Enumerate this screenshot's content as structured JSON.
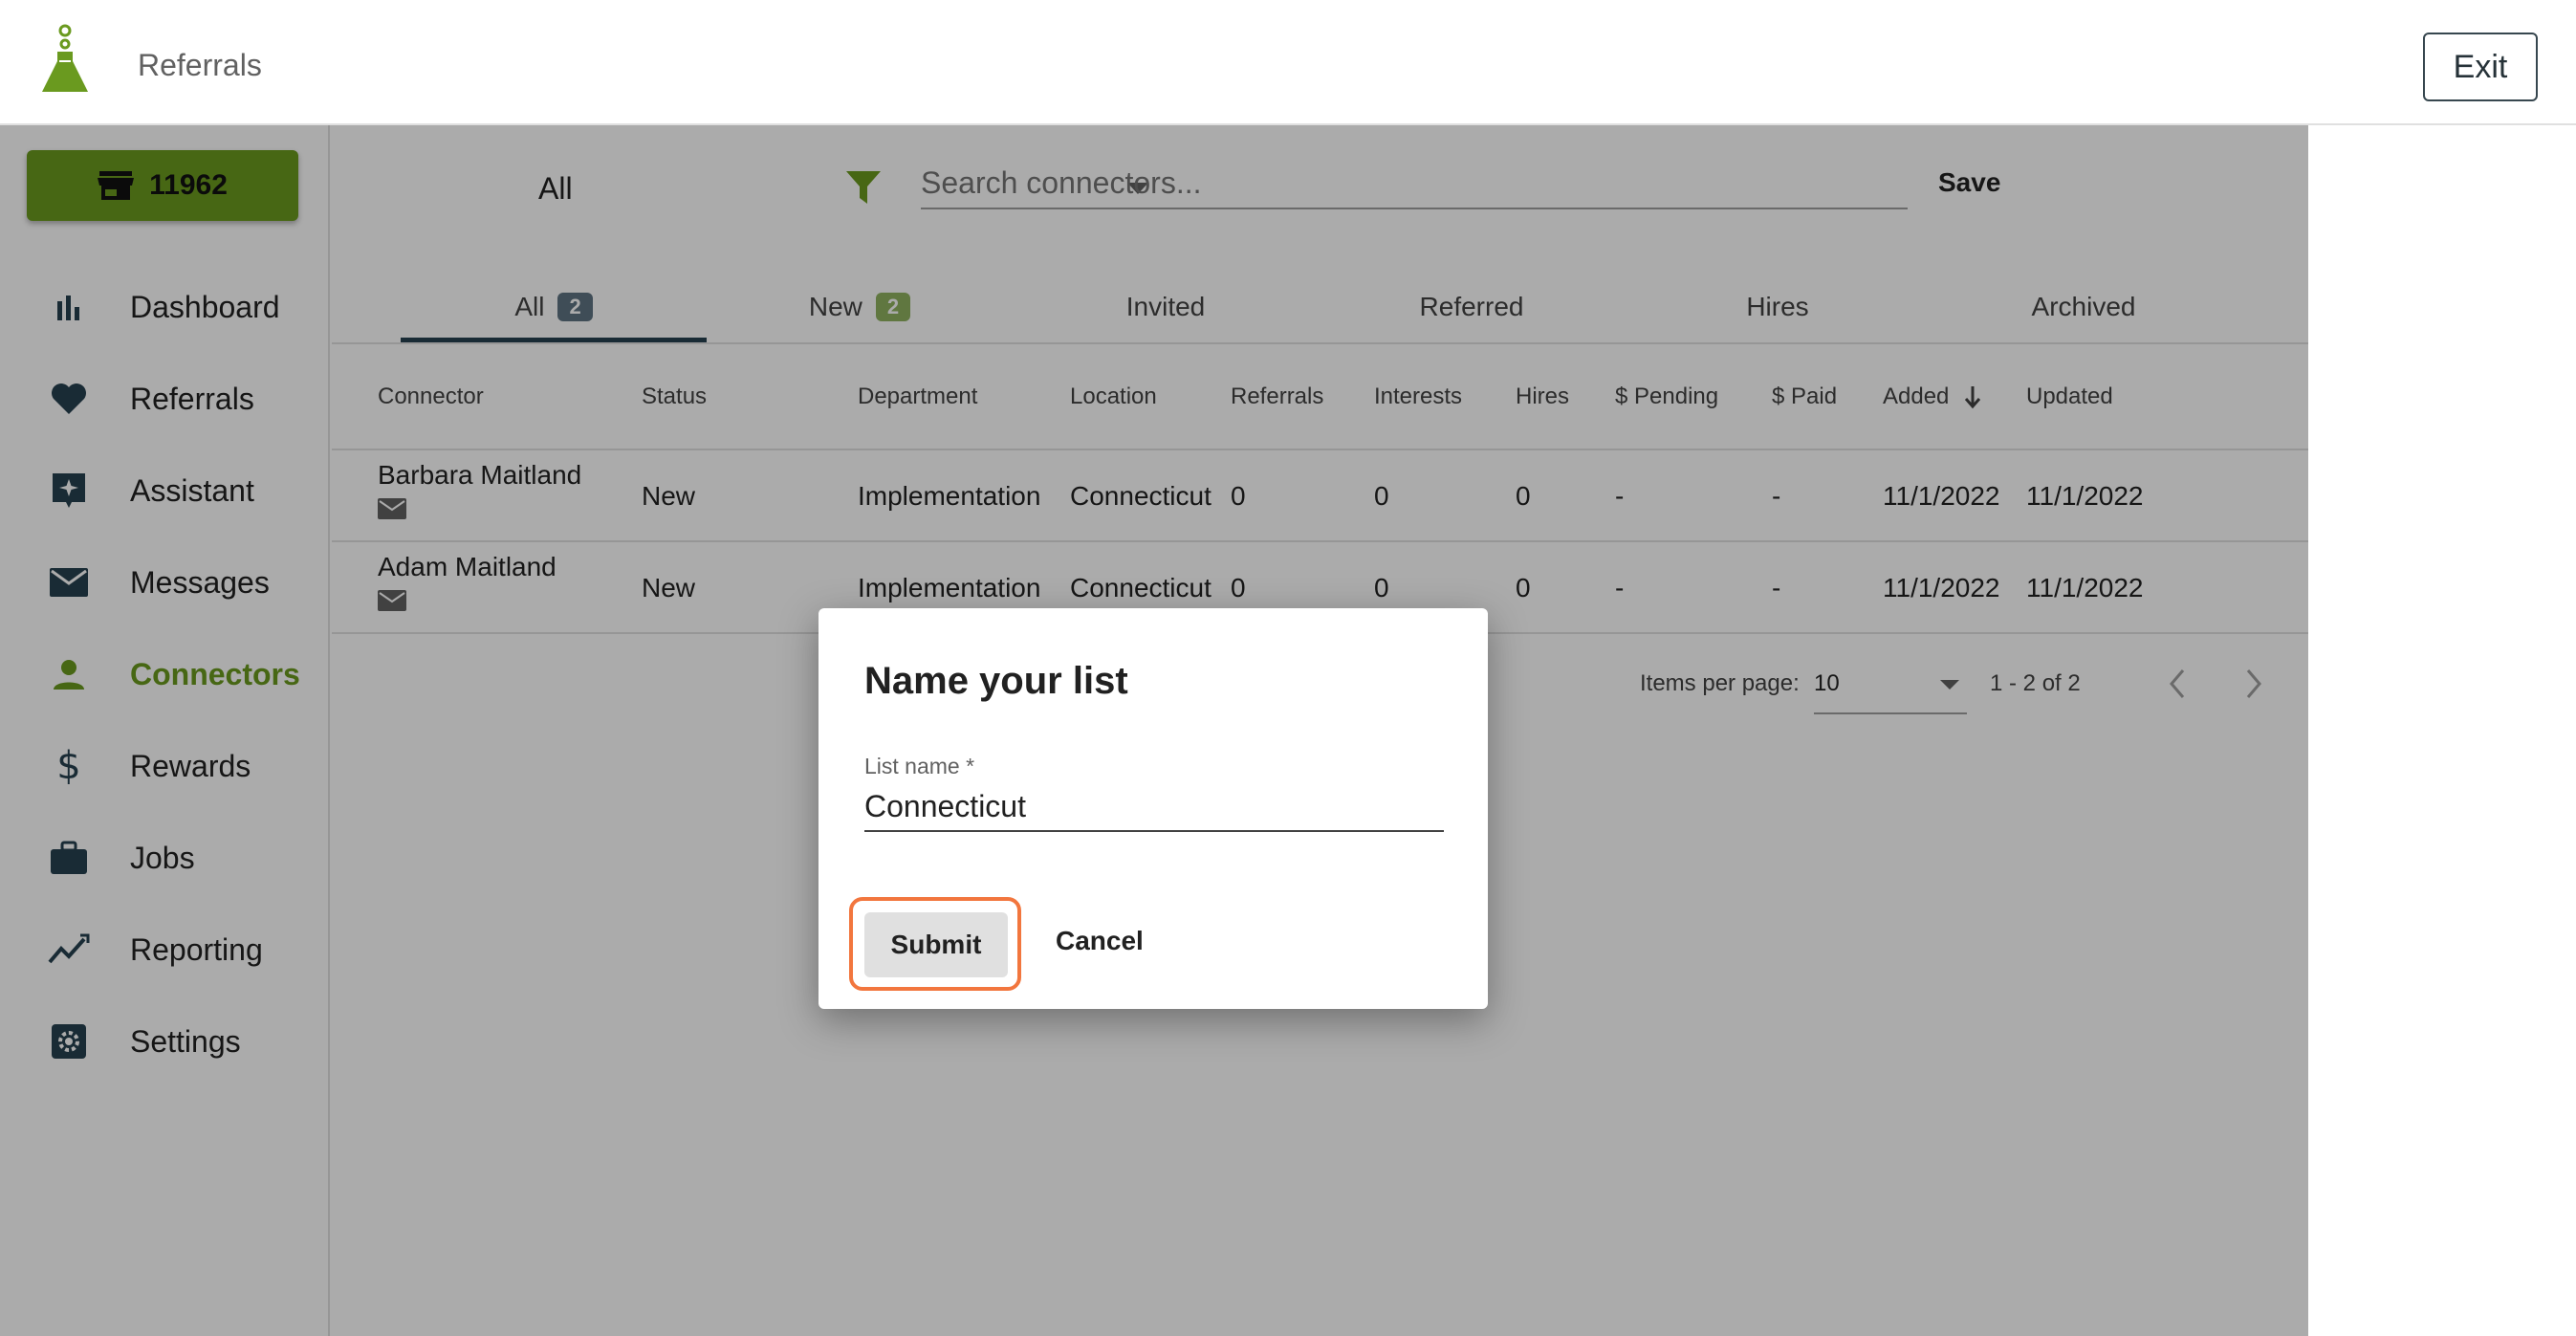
{
  "header": {
    "title": "Referrals",
    "exit_label": "Exit"
  },
  "sidebar": {
    "store_button": "11962",
    "items": [
      {
        "label": "Dashboard",
        "icon": "bar-chart-icon"
      },
      {
        "label": "Referrals",
        "icon": "heart-icon"
      },
      {
        "label": "Assistant",
        "icon": "sparkle-icon"
      },
      {
        "label": "Messages",
        "icon": "envelope-icon"
      },
      {
        "label": "Connectors",
        "icon": "person-icon",
        "active": true
      },
      {
        "label": "Rewards",
        "icon": "dollar-icon"
      },
      {
        "label": "Jobs",
        "icon": "briefcase-icon"
      },
      {
        "label": "Reporting",
        "icon": "trend-icon"
      },
      {
        "label": "Settings",
        "icon": "gear-icon"
      }
    ]
  },
  "toolbar": {
    "filter_value": "All",
    "search_placeholder": "Search connectors...",
    "save_label": "Save"
  },
  "tabs": [
    {
      "label": "All",
      "badge": "2"
    },
    {
      "label": "New",
      "badge": "2"
    },
    {
      "label": "Invited"
    },
    {
      "label": "Referred"
    },
    {
      "label": "Hires"
    },
    {
      "label": "Archived"
    }
  ],
  "table": {
    "headers": [
      "Connector",
      "Status",
      "Department",
      "Location",
      "Referrals",
      "Interests",
      "Hires",
      "$ Pending",
      "$ Paid",
      "Added",
      "Updated"
    ],
    "rows": [
      [
        "Barbara Maitland",
        "New",
        "Implementation",
        "Connecticut",
        "0",
        "0",
        "0",
        "-",
        "-",
        "11/1/2022",
        "11/1/2022"
      ],
      [
        "Adam Maitland",
        "New",
        "Implementation",
        "Connecticut",
        "0",
        "0",
        "0",
        "-",
        "-",
        "11/1/2022",
        "11/1/2022"
      ]
    ]
  },
  "pagination": {
    "items_per_page_label": "Items per page:",
    "items_per_page": "10",
    "range": "1 - 2 of 2"
  },
  "dialog": {
    "title": "Name your list",
    "field_label": "List name *",
    "field_value": "Connecticut",
    "submit_label": "Submit",
    "cancel_label": "Cancel"
  },
  "colors": {
    "brand_green": "#6a9a1f",
    "highlight": "#f2763e",
    "dark_slate": "#26414f"
  }
}
